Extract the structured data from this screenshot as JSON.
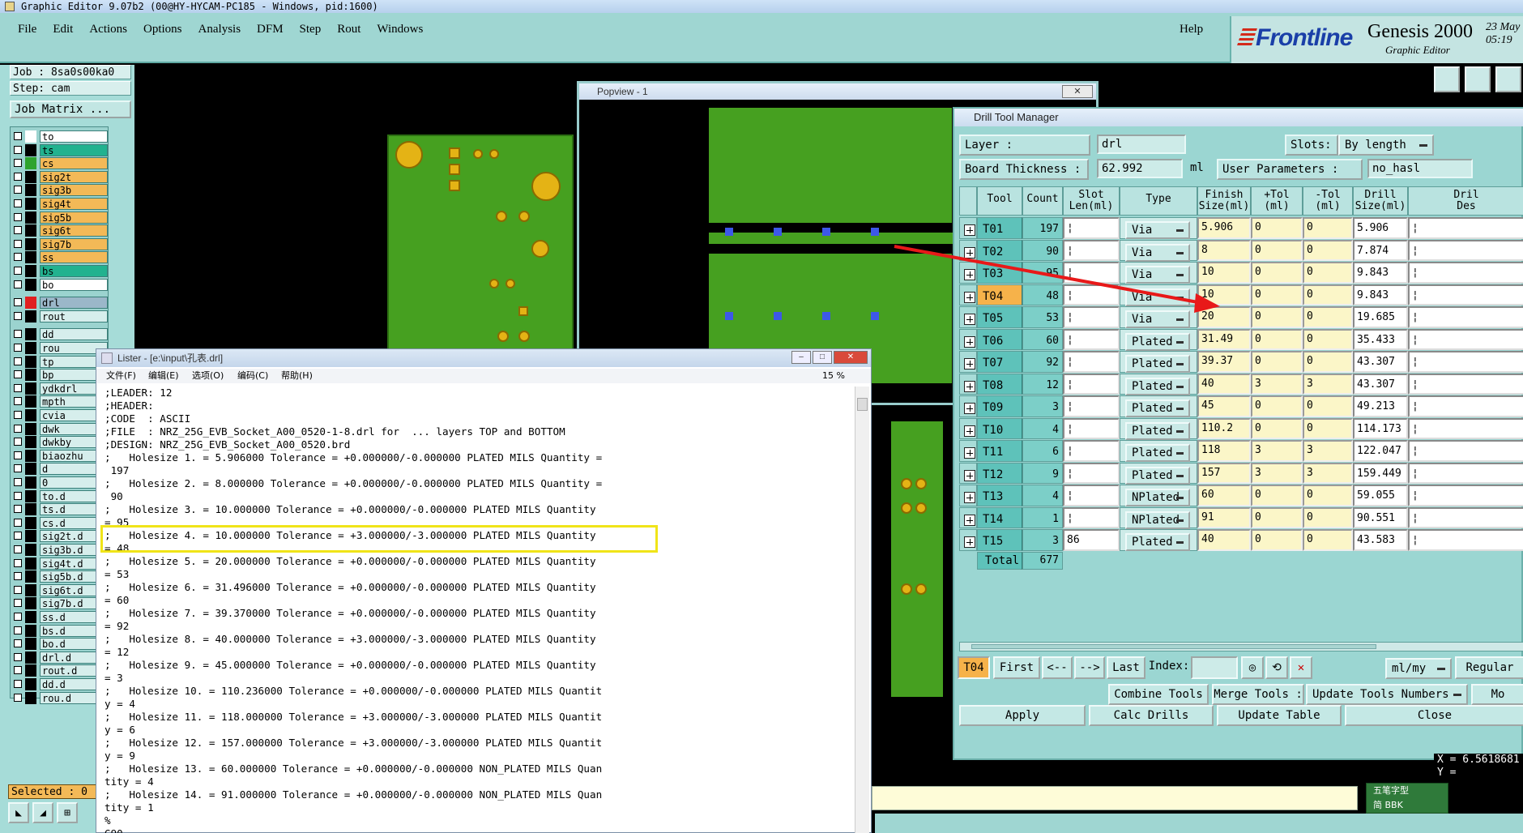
{
  "window": {
    "title": "Graphic Editor 9.07b2 (00@HY-HYCAM-PC185 - Windows, pid:1600)"
  },
  "menu": {
    "items": [
      "File",
      "Edit",
      "Actions",
      "Options",
      "Analysis",
      "DFM",
      "Step",
      "Rout",
      "Windows"
    ],
    "help": "Help"
  },
  "brand": {
    "logo": "Frontline",
    "product": "Genesis 2000",
    "subtitle": "Graphic Editor",
    "date_line1": "23 May",
    "date_line2": "05:19"
  },
  "left_panel": {
    "job": "Job : 8sa0s00ka0",
    "step": "Step: cam",
    "job_matrix": "Job Matrix ...",
    "layers": [
      {
        "name": "to",
        "color": "#ffffff",
        "bg": "#ffffff"
      },
      {
        "name": "ts",
        "color": "#000000",
        "bg": "#22b28f"
      },
      {
        "name": "cs",
        "color": "#2ea32e",
        "bg": "#f3b957"
      },
      {
        "name": "sig2t",
        "color": "#000000",
        "bg": "#f3b957"
      },
      {
        "name": "sig3b",
        "color": "#000000",
        "bg": "#f3b957"
      },
      {
        "name": "sig4t",
        "color": "#000000",
        "bg": "#f3b957"
      },
      {
        "name": "sig5b",
        "color": "#000000",
        "bg": "#f3b957"
      },
      {
        "name": "sig6t",
        "color": "#000000",
        "bg": "#f3b957"
      },
      {
        "name": "sig7b",
        "color": "#000000",
        "bg": "#f3b957"
      },
      {
        "name": "ss",
        "color": "#000000",
        "bg": "#f3b957"
      },
      {
        "name": "bs",
        "color": "#000000",
        "bg": "#22b28f"
      },
      {
        "name": "bo",
        "color": "#000000",
        "bg": "#ffffff"
      },
      {
        "name": "drl",
        "color": "#e02020",
        "bg": "#9bb7c9"
      },
      {
        "name": "rout",
        "color": "#000000",
        "bg": "#d6eeec"
      },
      {
        "name": "dd",
        "color": "#000000",
        "bg": "#d6eeec"
      },
      {
        "name": "rou",
        "color": "#000000",
        "bg": "#d6eeec"
      },
      {
        "name": "tp",
        "color": "#000000",
        "bg": "#d6eeec"
      },
      {
        "name": "bp",
        "color": "#000000",
        "bg": "#d6eeec"
      },
      {
        "name": "ydkdrl",
        "color": "#000000",
        "bg": "#d6eeec"
      },
      {
        "name": "mpth",
        "color": "#000000",
        "bg": "#d6eeec"
      },
      {
        "name": "cvia",
        "color": "#000000",
        "bg": "#d6eeec"
      },
      {
        "name": "dwk",
        "color": "#000000",
        "bg": "#d6eeec"
      },
      {
        "name": "dwkby",
        "color": "#000000",
        "bg": "#d6eeec"
      },
      {
        "name": "biaozhu",
        "color": "#000000",
        "bg": "#d6eeec"
      },
      {
        "name": "d",
        "color": "#000000",
        "bg": "#d6eeec"
      },
      {
        "name": "0",
        "color": "#000000",
        "bg": "#d6eeec"
      },
      {
        "name": "to.d",
        "color": "#000000",
        "bg": "#d6eeec"
      },
      {
        "name": "ts.d",
        "color": "#000000",
        "bg": "#d6eeec"
      },
      {
        "name": "cs.d",
        "color": "#000000",
        "bg": "#d6eeec"
      },
      {
        "name": "sig2t.d",
        "color": "#000000",
        "bg": "#d6eeec"
      },
      {
        "name": "sig3b.d",
        "color": "#000000",
        "bg": "#d6eeec"
      },
      {
        "name": "sig4t.d",
        "color": "#000000",
        "bg": "#d6eeec"
      },
      {
        "name": "sig5b.d",
        "color": "#000000",
        "bg": "#d6eeec"
      },
      {
        "name": "sig6t.d",
        "color": "#000000",
        "bg": "#d6eeec"
      },
      {
        "name": "sig7b.d",
        "color": "#000000",
        "bg": "#d6eeec"
      },
      {
        "name": "ss.d",
        "color": "#000000",
        "bg": "#d6eeec"
      },
      {
        "name": "bs.d",
        "color": "#000000",
        "bg": "#d6eeec"
      },
      {
        "name": "bo.d",
        "color": "#000000",
        "bg": "#d6eeec"
      },
      {
        "name": "drl.d",
        "color": "#000000",
        "bg": "#d6eeec"
      },
      {
        "name": "rout.d",
        "color": "#000000",
        "bg": "#d6eeec"
      },
      {
        "name": "dd.d",
        "color": "#000000",
        "bg": "#d6eeec"
      },
      {
        "name": "rou.d",
        "color": "#000000",
        "bg": "#d6eeec"
      }
    ],
    "selected": "Selected : 0"
  },
  "popview": {
    "title": "Popview - 1"
  },
  "drill_tool_manager": {
    "title": "Drill Tool Manager",
    "layer_label": "Layer          :",
    "layer_value": "drl",
    "slots_label": "Slots:",
    "slots_value": "By length",
    "thickness_label": "Board Thickness :",
    "thickness_value": "62.992",
    "thickness_unit": "ml",
    "user_params_label": "User Parameters :",
    "user_params_value": "no_hasl",
    "headers": [
      "Tool",
      "Count",
      "Slot\nLen(ml)",
      "Type",
      "Finish\nSize(ml)",
      "+Tol\n(ml)",
      "-Tol\n(ml)",
      "Drill\nSize(ml)",
      "Dril\nDes"
    ],
    "rows": [
      {
        "tool": "T01",
        "count": "197",
        "slot": "",
        "type": "Via",
        "finish": "5.906",
        "ptol": "0",
        "ntol": "0",
        "drill": "5.906"
      },
      {
        "tool": "T02",
        "count": "90",
        "slot": "",
        "type": "Via",
        "finish": "8",
        "ptol": "0",
        "ntol": "0",
        "drill": "7.874"
      },
      {
        "tool": "T03",
        "count": "95",
        "slot": "",
        "type": "Via",
        "finish": "10",
        "ptol": "0",
        "ntol": "0",
        "drill": "9.843"
      },
      {
        "tool": "T04",
        "count": "48",
        "slot": "",
        "type": "Via",
        "finish": "10",
        "ptol": "0",
        "ntol": "0",
        "drill": "9.843"
      },
      {
        "tool": "T05",
        "count": "53",
        "slot": "",
        "type": "Via",
        "finish": "20",
        "ptol": "0",
        "ntol": "0",
        "drill": "19.685"
      },
      {
        "tool": "T06",
        "count": "60",
        "slot": "",
        "type": "Plated",
        "finish": "31.49",
        "ptol": "0",
        "ntol": "0",
        "drill": "35.433"
      },
      {
        "tool": "T07",
        "count": "92",
        "slot": "",
        "type": "Plated",
        "finish": "39.37",
        "ptol": "0",
        "ntol": "0",
        "drill": "43.307"
      },
      {
        "tool": "T08",
        "count": "12",
        "slot": "",
        "type": "Plated",
        "finish": "40",
        "ptol": "3",
        "ntol": "3",
        "drill": "43.307"
      },
      {
        "tool": "T09",
        "count": "3",
        "slot": "",
        "type": "Plated",
        "finish": "45",
        "ptol": "0",
        "ntol": "0",
        "drill": "49.213"
      },
      {
        "tool": "T10",
        "count": "4",
        "slot": "",
        "type": "Plated",
        "finish": "110.2",
        "ptol": "0",
        "ntol": "0",
        "drill": "114.173"
      },
      {
        "tool": "T11",
        "count": "6",
        "slot": "",
        "type": "Plated",
        "finish": "118",
        "ptol": "3",
        "ntol": "3",
        "drill": "122.047"
      },
      {
        "tool": "T12",
        "count": "9",
        "slot": "",
        "type": "Plated",
        "finish": "157",
        "ptol": "3",
        "ntol": "3",
        "drill": "159.449"
      },
      {
        "tool": "T13",
        "count": "4",
        "slot": "",
        "type": "NPlated",
        "finish": "60",
        "ptol": "0",
        "ntol": "0",
        "drill": "59.055"
      },
      {
        "tool": "T14",
        "count": "1",
        "slot": "",
        "type": "NPlated",
        "finish": "91",
        "ptol": "0",
        "ntol": "0",
        "drill": "90.551"
      },
      {
        "tool": "T15",
        "count": "3",
        "slot": "86",
        "type": "Plated",
        "finish": "40",
        "ptol": "0",
        "ntol": "0",
        "drill": "43.583"
      }
    ],
    "selected_tool": "T04",
    "total_label": "Total",
    "total_value": "677",
    "nav": {
      "current": "T04",
      "first": "First",
      "prev": "<--",
      "next": "-->",
      "last": "Last",
      "index_label": "Index:",
      "units": "ml/my",
      "regular": "Regular"
    },
    "actions": {
      "combine": "Combine Tools",
      "merge": "Merge Tools :",
      "update_numbers": "Update Tools Numbers",
      "more": "Mo",
      "apply": "Apply",
      "calc": "Calc Drills",
      "update_table": "Update Table",
      "close": "Close"
    }
  },
  "lister": {
    "title": "Lister - [e:\\input\\孔表.drl]",
    "menu": [
      "文件(F)",
      "编辑(E)",
      "选项(O)",
      "编码(C)",
      "帮助(H)"
    ],
    "zoom": "15 %",
    "lines": [
      ";LEADER: 12",
      ";HEADER:",
      ";CODE  : ASCII",
      ";FILE  : NRZ_25G_EVB_Socket_A00_0520-1-8.drl for  ... layers TOP and BOTTOM",
      ";DESIGN: NRZ_25G_EVB_Socket_A00_0520.brd",
      ";   Holesize 1. = 5.906000 Tolerance = +0.000000/-0.000000 PLATED MILS Quantity =",
      " 197",
      ";   Holesize 2. = 8.000000 Tolerance = +0.000000/-0.000000 PLATED MILS Quantity =",
      " 90",
      ";   Holesize 3. = 10.000000 Tolerance = +0.000000/-0.000000 PLATED MILS Quantity",
      "= 95",
      ";   Holesize 4. = 10.000000 Tolerance = +3.000000/-3.000000 PLATED MILS Quantity",
      "= 48",
      ";   Holesize 5. = 20.000000 Tolerance = +0.000000/-0.000000 PLATED MILS Quantity",
      "= 53",
      ";   Holesize 6. = 31.496000 Tolerance = +0.000000/-0.000000 PLATED MILS Quantity",
      "= 60",
      ";   Holesize 7. = 39.370000 Tolerance = +0.000000/-0.000000 PLATED MILS Quantity",
      "= 92",
      ";   Holesize 8. = 40.000000 Tolerance = +3.000000/-3.000000 PLATED MILS Quantity",
      "= 12",
      ";   Holesize 9. = 45.000000 Tolerance = +0.000000/-0.000000 PLATED MILS Quantity",
      "= 3",
      ";   Holesize 10. = 110.236000 Tolerance = +0.000000/-0.000000 PLATED MILS Quantit",
      "y = 4",
      ";   Holesize 11. = 118.000000 Tolerance = +3.000000/-3.000000 PLATED MILS Quantit",
      "y = 6",
      ";   Holesize 12. = 157.000000 Tolerance = +3.000000/-3.000000 PLATED MILS Quantit",
      "y = 9",
      ";   Holesize 13. = 60.000000 Tolerance = +0.000000/-0.000000 NON_PLATED MILS Quan",
      "tity = 4",
      ";   Holesize 14. = 91.000000 Tolerance = +0.000000/-0.000000 NON_PLATED MILS Quan",
      "tity = 1",
      "%",
      "G90"
    ]
  },
  "coords": {
    "x": "X = 6.5618681",
    "y": "Y ="
  },
  "ime": {
    "line1": "五笔字型",
    "line2": "简 BBK"
  }
}
